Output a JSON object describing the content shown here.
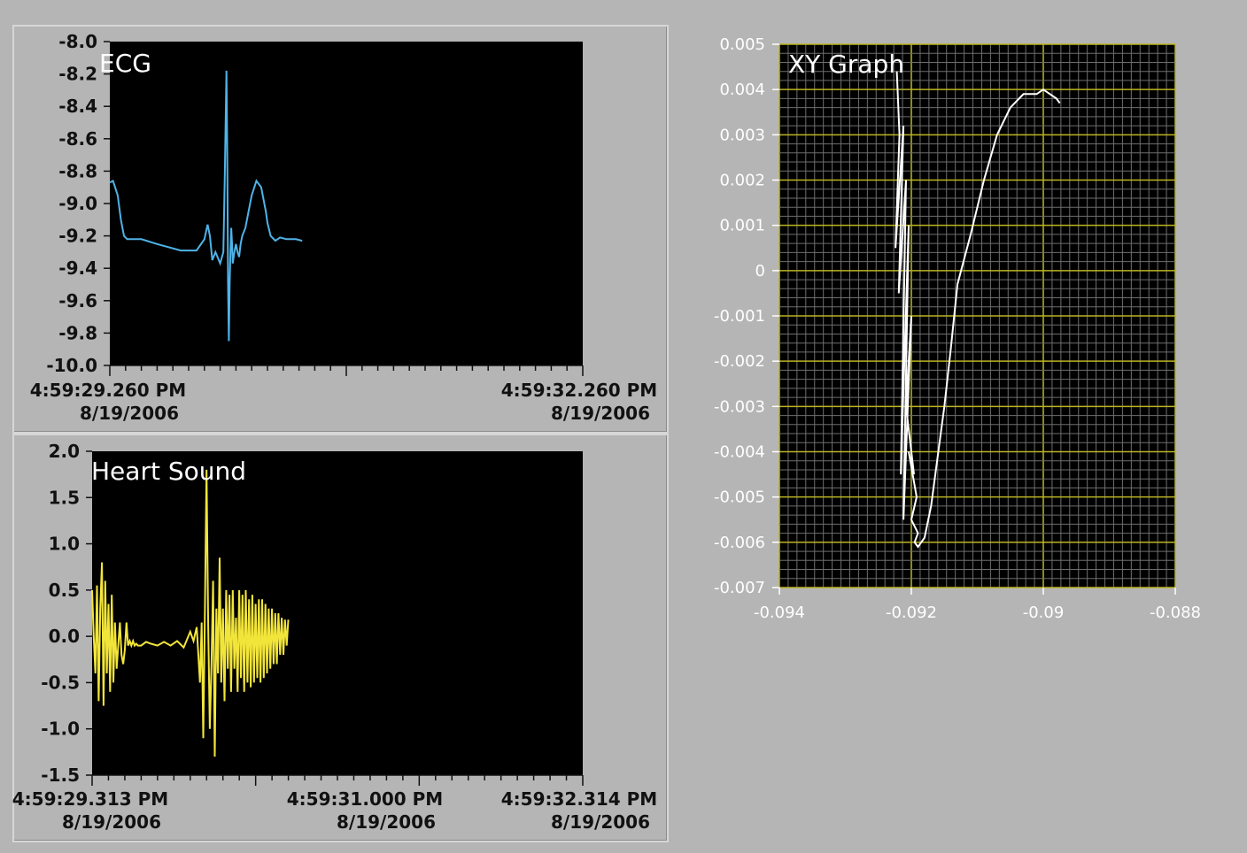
{
  "charts": {
    "ecg": {
      "type": "line",
      "title": "ECG",
      "ylim": [
        -10.0,
        -8.0
      ],
      "y_ticks": [
        "-8.0",
        "-8.2",
        "-8.4",
        "-8.6",
        "-8.8",
        "-9.0",
        "-9.2",
        "-9.4",
        "-9.6",
        "-9.8",
        "-10.0"
      ],
      "x_start": {
        "time": "4:59:29.260 PM",
        "date": "8/19/2006"
      },
      "x_end": {
        "time": "4:59:32.260 PM",
        "date": "8/19/2006"
      },
      "x_range_seconds": [
        0,
        3.0
      ],
      "grid": false,
      "line_color": "#4fb3e8",
      "series": [
        {
          "x": [
            0.0,
            0.02,
            0.05,
            0.07,
            0.09,
            0.11,
            0.15,
            0.2,
            0.3,
            0.45,
            0.55,
            0.6,
            0.62,
            0.635,
            0.65,
            0.67,
            0.7,
            0.72,
            0.73,
            0.74,
            0.745,
            0.75,
            0.755,
            0.76,
            0.765,
            0.77,
            0.775,
            0.78,
            0.79,
            0.8,
            0.81,
            0.82,
            0.83,
            0.84,
            0.86,
            0.88,
            0.9,
            0.93,
            0.96,
            0.99,
            1.0,
            1.02,
            1.05,
            1.08,
            1.12,
            1.18,
            1.22
          ],
          "y": [
            -8.87,
            -8.86,
            -8.95,
            -9.1,
            -9.2,
            -9.22,
            -9.22,
            -9.22,
            -9.25,
            -9.29,
            -9.29,
            -9.22,
            -9.13,
            -9.2,
            -9.35,
            -9.3,
            -9.37,
            -9.3,
            -8.8,
            -8.18,
            -8.7,
            -9.5,
            -9.85,
            -9.5,
            -9.3,
            -9.15,
            -9.25,
            -9.37,
            -9.3,
            -9.25,
            -9.3,
            -9.33,
            -9.25,
            -9.2,
            -9.15,
            -9.05,
            -8.95,
            -8.86,
            -8.9,
            -9.05,
            -9.12,
            -9.2,
            -9.23,
            -9.21,
            -9.22,
            -9.22,
            -9.23
          ]
        }
      ]
    },
    "heart_sound": {
      "type": "line",
      "title": "Heart Sound",
      "ylim": [
        -1.5,
        2.0
      ],
      "y_ticks": [
        "2.0",
        "1.5",
        "1.0",
        "0.5",
        "0.0",
        "-0.5",
        "-1.0",
        "-1.5"
      ],
      "x_labels": [
        {
          "time": "4:59:29.313 PM",
          "date": "8/19/2006"
        },
        {
          "time": "4:59:31.000 PM",
          "date": "8/19/2006"
        },
        {
          "time": "4:59:32.314 PM",
          "date": "8/19/2006"
        }
      ],
      "x_range_seconds": [
        0,
        3.001
      ],
      "grid": false,
      "line_color": "#f2e53a",
      "series": [
        {
          "x": [
            0.0,
            0.01,
            0.02,
            0.03,
            0.04,
            0.05,
            0.06,
            0.07,
            0.08,
            0.09,
            0.1,
            0.11,
            0.12,
            0.13,
            0.14,
            0.15,
            0.16,
            0.17,
            0.18,
            0.19,
            0.2,
            0.21,
            0.22,
            0.23,
            0.24,
            0.25,
            0.26,
            0.27,
            0.28,
            0.3,
            0.33,
            0.36,
            0.4,
            0.44,
            0.48,
            0.52,
            0.56,
            0.6,
            0.62,
            0.64,
            0.66,
            0.67,
            0.68,
            0.69,
            0.7,
            0.71,
            0.72,
            0.73,
            0.74,
            0.75,
            0.76,
            0.77,
            0.78,
            0.79,
            0.8,
            0.81,
            0.82,
            0.83,
            0.84,
            0.85,
            0.86,
            0.87,
            0.88,
            0.89,
            0.9,
            0.91,
            0.92,
            0.93,
            0.94,
            0.95,
            0.96,
            0.97,
            0.98,
            0.99,
            1.0,
            1.01,
            1.02,
            1.03,
            1.04,
            1.05,
            1.06,
            1.07,
            1.08,
            1.09,
            1.1,
            1.11,
            1.12,
            1.13,
            1.14,
            1.15,
            1.16,
            1.17,
            1.18,
            1.19,
            1.2
          ],
          "y": [
            0.5,
            0.0,
            -0.4,
            0.55,
            -0.7,
            0.3,
            0.8,
            -0.75,
            0.6,
            -0.4,
            0.35,
            -0.6,
            0.45,
            -0.5,
            0.15,
            -0.35,
            -0.1,
            0.15,
            -0.2,
            -0.3,
            -0.15,
            0.15,
            -0.1,
            -0.05,
            -0.1,
            -0.05,
            -0.1,
            -0.08,
            -0.1,
            -0.1,
            -0.06,
            -0.08,
            -0.1,
            -0.06,
            -0.1,
            -0.05,
            -0.12,
            0.05,
            -0.05,
            0.1,
            -0.5,
            0.15,
            -1.1,
            0.3,
            1.8,
            0.1,
            -1.0,
            -0.3,
            0.6,
            -1.3,
            0.3,
            -0.4,
            0.85,
            -0.5,
            0.3,
            -0.7,
            0.5,
            -0.35,
            0.45,
            -0.6,
            0.5,
            -0.35,
            0.2,
            -0.6,
            0.5,
            -0.45,
            0.45,
            -0.6,
            0.5,
            -0.5,
            0.4,
            -0.55,
            0.45,
            -0.5,
            0.35,
            -0.45,
            0.4,
            -0.5,
            0.4,
            -0.45,
            0.35,
            -0.4,
            0.3,
            -0.35,
            0.3,
            -0.3,
            0.25,
            -0.3,
            0.25,
            -0.2,
            0.2,
            -0.2,
            0.18,
            -0.1,
            0.18
          ]
        }
      ]
    },
    "xy": {
      "type": "line",
      "title": "XY Graph",
      "xlim": [
        -0.094,
        -0.088
      ],
      "ylim": [
        -0.007,
        0.005
      ],
      "x_ticks": [
        "-0.094",
        "-0.092",
        "-0.09",
        "-0.088"
      ],
      "y_ticks": [
        "0.005",
        "0.004",
        "0.003",
        "0.002",
        "0.001",
        "0",
        "-0.001",
        "-0.002",
        "-0.003",
        "-0.004",
        "-0.005",
        "-0.006",
        "-0.007"
      ],
      "grid": true,
      "background": "#000000",
      "major_grid_color": "#bcb423",
      "minor_grid_color": "#6e6e6e",
      "line_color": "#ffffff",
      "series": [
        {
          "x": [
            -0.09222,
            -0.09218,
            -0.09224,
            -0.09212,
            -0.09219,
            -0.09208,
            -0.09216,
            -0.09204,
            -0.09212,
            -0.092,
            -0.09208,
            -0.09196,
            -0.09204,
            -0.09192,
            -0.092,
            -0.0919,
            -0.09195,
            -0.0919,
            -0.0918,
            -0.0917,
            -0.0916,
            -0.0915,
            -0.0914,
            -0.0913,
            -0.0911,
            -0.0909,
            -0.0907,
            -0.0905,
            -0.0903,
            -0.0901,
            -0.09,
            -0.0899,
            -0.0898,
            -0.08975
          ],
          "y": [
            0.0044,
            0.003,
            0.0005,
            0.0032,
            -0.0005,
            0.002,
            -0.0045,
            0.001,
            -0.0055,
            -0.001,
            -0.003,
            -0.0045,
            -0.004,
            -0.005,
            -0.0055,
            -0.0058,
            -0.006,
            -0.0061,
            -0.0059,
            -0.0052,
            -0.0041,
            -0.003,
            -0.0017,
            -0.0003,
            0.0008,
            0.002,
            0.003,
            0.0036,
            0.0039,
            0.0039,
            0.004,
            0.0039,
            0.0038,
            0.0037
          ]
        }
      ]
    }
  }
}
